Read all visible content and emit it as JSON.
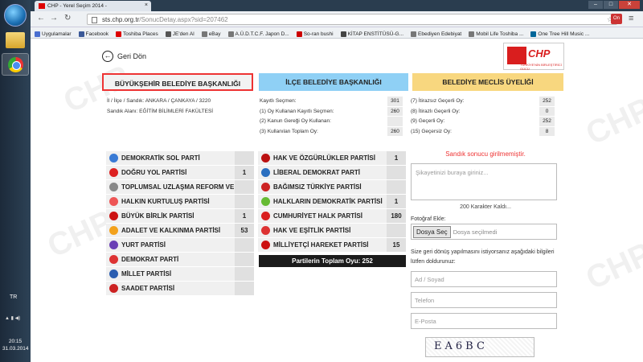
{
  "tab": {
    "title": "CHP - Yerel Seçim 2014 - "
  },
  "omnibox": {
    "domain": "sts.chp.org.tr",
    "path": "/SonucDetay.aspx?sid=207462"
  },
  "bookmarks": [
    {
      "label": "Uygulamalar",
      "color": "#4a6fd0"
    },
    {
      "label": "Facebook",
      "color": "#3b5998"
    },
    {
      "label": "Toshiba Places",
      "color": "#d00"
    },
    {
      "label": "JE'den Al",
      "color": "#555"
    },
    {
      "label": "eBay",
      "color": "#777"
    },
    {
      "label": "A.Ü.D.T.C.F. Japon D...",
      "color": "#777"
    },
    {
      "label": "So-ran bushi",
      "color": "#c00"
    },
    {
      "label": "KİTAP ENSTİTÜSÜ-G...",
      "color": "#444"
    },
    {
      "label": "Ebediyen Edebiyat",
      "color": "#777"
    },
    {
      "label": "Mobil Life Toshiba ...",
      "color": "#777"
    },
    {
      "label": "One Tree Hill Music ...",
      "color": "#069"
    }
  ],
  "taskbar": {
    "lang": "TR",
    "time": "20:15",
    "date": "31.03.2014"
  },
  "back": {
    "label": "Geri Dön"
  },
  "logo": {
    "text": "CHP",
    "sub": "TÜRKİYE'NİN BİRLEŞTİRİCİ GÜCÜ"
  },
  "headers": {
    "h1": "BÜYÜKŞEHİR BELEDİYE BAŞKANLIĞI",
    "h2": "İLÇE BELEDİYE BAŞKANLIĞI",
    "h3": "BELEDİYE MECLİS ÜYELİĞİ"
  },
  "location": {
    "line1": "İl / İlçe / Sandık: ANKARA / ÇANKAYA / 3220",
    "line2": "Sandık Alanı: EĞİTİM BİLİMLERİ FAKÜLTESİ"
  },
  "mid_info": {
    "labels": [
      "Kayıtlı Seçmen:",
      "(1) Oy Kullanan Kayıtlı Seçmen:",
      "(2) Kanun Gereği Oy Kullanan:",
      "(3) Kullanılan Toplam Oy:"
    ],
    "values": [
      "301",
      "260",
      "",
      "260"
    ]
  },
  "right_info": {
    "labels": [
      "(7) İtirazsız Geçerli Oy:",
      "(8) İtirazlı Geçerli Oy:",
      "(9) Geçerli Oy:",
      "(15) Geçersiz Oy:"
    ],
    "values": [
      "252",
      "0",
      "252",
      "8"
    ]
  },
  "left_parties": [
    {
      "name": "DEMOKRATİK SOL PARTİ",
      "value": "",
      "color": "#3a7bd5"
    },
    {
      "name": "DOĞRU YOL PARTİSİ",
      "value": "1",
      "color": "#d22"
    },
    {
      "name": "TOPLUMSAL UZLAŞMA REFORM VE",
      "value": "",
      "color": "#888"
    },
    {
      "name": "HALKIN KURTULUŞ PARTİSİ",
      "value": "",
      "color": "#e55"
    },
    {
      "name": "BÜYÜK BİRLİK PARTİSİ",
      "value": "1",
      "color": "#c11"
    },
    {
      "name": "ADALET VE KALKINMA PARTİSİ",
      "value": "53",
      "color": "#f3a21c"
    },
    {
      "name": "YURT PARTİSİ",
      "value": "",
      "color": "#6a3fb5"
    },
    {
      "name": "DEMOKRAT PARTİ",
      "value": "",
      "color": "#d33"
    },
    {
      "name": "MİLLET PARTİSİ",
      "value": "",
      "color": "#2a5db0"
    },
    {
      "name": "SAADET PARTİSİ",
      "value": "",
      "color": "#c22"
    }
  ],
  "mid_parties": [
    {
      "name": "HAK VE ÖZGÜRLÜKLER PARTİSİ",
      "value": "1",
      "color": "#b11"
    },
    {
      "name": "LİBERAL DEMOKRAT PARTİ",
      "value": "",
      "color": "#2a6fc0"
    },
    {
      "name": "BAĞIMSIZ TÜRKİYE PARTİSİ",
      "value": "",
      "color": "#c22"
    },
    {
      "name": "HALKLARIN DEMOKRATİK PARTİSİ",
      "value": "1",
      "color": "#6b3"
    },
    {
      "name": "CUMHURİYET HALK PARTİSİ",
      "value": "180",
      "color": "#d91e1e"
    },
    {
      "name": "HAK VE EŞİTLİK PARTİSİ",
      "value": "",
      "color": "#d33"
    },
    {
      "name": "MİLLİYETÇİ HAREKET PARTİSİ",
      "value": "15",
      "color": "#c11"
    }
  ],
  "total": "Partilerin Toplam Oyu: 252",
  "form": {
    "warning": "Sandık sonucu girilmemiştir.",
    "complaint_placeholder": "Şikayetinizi buraya giriniz...",
    "chars_left": "200 Karakter Kaldı...",
    "photo_label": "Fotoğraf Ekle:",
    "file_button": "Dosya Seç",
    "file_status": "Dosya seçilmedi",
    "info": "Size geri dönüş yapılmasını istiyorsanız aşağıdaki bilgileri lütfen doldurunuz:",
    "name_placeholder": "Ad / Soyad",
    "phone_placeholder": "Telefon",
    "email_placeholder": "E-Posta",
    "captcha": "EA6BC"
  }
}
